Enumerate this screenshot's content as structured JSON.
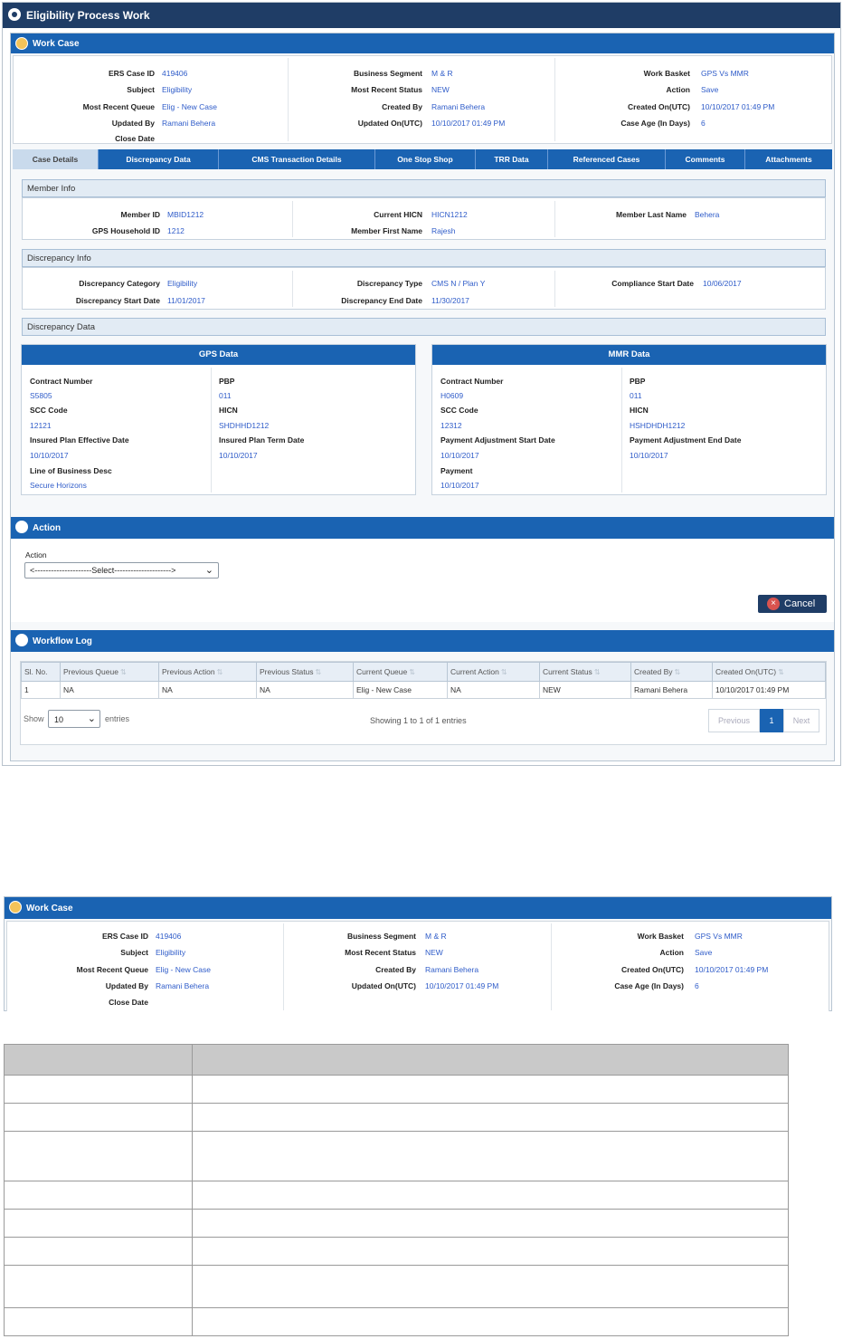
{
  "window": {
    "title": "Eligibility Process Work"
  },
  "work_case": {
    "title": "Work Case",
    "col1": [
      {
        "label": "ERS Case ID",
        "value": "419406"
      },
      {
        "label": "Subject",
        "value": "Eligibility"
      },
      {
        "label": "Most Recent Queue",
        "value": "Elig - New Case"
      },
      {
        "label": "Updated By",
        "value": "Ramani Behera"
      },
      {
        "label": "Close Date",
        "value": ""
      }
    ],
    "col2": [
      {
        "label": "Business Segment",
        "value": "M & R"
      },
      {
        "label": "Most Recent Status",
        "value": "NEW"
      },
      {
        "label": "Created By",
        "value": "Ramani Behera"
      },
      {
        "label": "Updated On(UTC)",
        "value": "10/10/2017 01:49 PM"
      }
    ],
    "col3": [
      {
        "label": "Work Basket",
        "value": "GPS Vs MMR"
      },
      {
        "label": "Action",
        "value": "Save"
      },
      {
        "label": "Created On(UTC)",
        "value": "10/10/2017 01:49 PM"
      },
      {
        "label": "Case Age (In Days)",
        "value": "6"
      }
    ]
  },
  "tabs": [
    "Case Details",
    "Discrepancy Data",
    "CMS Transaction Details",
    "One Stop Shop",
    "TRR Data",
    "Referenced Cases",
    "Comments",
    "Attachments"
  ],
  "member_info": {
    "title": "Member Info",
    "member_id": {
      "label": "Member ID",
      "value": "MBID1212"
    },
    "gps_household_id": {
      "label": "GPS Household ID",
      "value": "1212"
    },
    "current_hicn": {
      "label": "Current HICN",
      "value": "HICN1212"
    },
    "member_first_name": {
      "label": "Member First Name",
      "value": "Rajesh"
    },
    "member_last_name": {
      "label": "Member Last Name",
      "value": "Behera"
    }
  },
  "discrepancy_info": {
    "title": "Discrepancy Info",
    "category": {
      "label": "Discrepancy Category",
      "value": "Eligibility"
    },
    "start_date": {
      "label": "Discrepancy Start Date",
      "value": "11/01/2017"
    },
    "type": {
      "label": "Discrepancy Type",
      "value": "CMS N / Plan Y"
    },
    "end_date": {
      "label": "Discrepancy End Date",
      "value": "11/30/2017"
    },
    "compliance_start": {
      "label": "Compliance Start Date",
      "value": "10/06/2017"
    }
  },
  "discrepancy_data": {
    "title": "Discrepancy Data"
  },
  "gps_data": {
    "title": "GPS Data",
    "left": [
      {
        "label": "Contract Number",
        "value": "S5805"
      },
      {
        "label": "SCC Code",
        "value": "12121"
      },
      {
        "label": "Insured Plan Effective Date",
        "value": "10/10/2017"
      },
      {
        "label": "Line of Business Desc",
        "value": "Secure Horizons"
      }
    ],
    "right": [
      {
        "label": "PBP",
        "value": "011"
      },
      {
        "label": "HICN",
        "value": "SHDHHD1212"
      },
      {
        "label": "Insured Plan Term Date",
        "value": "10/10/2017"
      }
    ]
  },
  "mmr_data": {
    "title": "MMR Data",
    "left": [
      {
        "label": "Contract Number",
        "value": "H0609"
      },
      {
        "label": "SCC Code",
        "value": "12312"
      },
      {
        "label": "Payment Adjustment Start Date",
        "value": "10/10/2017"
      },
      {
        "label": "Payment",
        "value": "10/10/2017"
      }
    ],
    "right": [
      {
        "label": "PBP",
        "value": "011"
      },
      {
        "label": "HICN",
        "value": "HSHDHDH1212"
      },
      {
        "label": "Payment Adjustment End Date",
        "value": "10/10/2017"
      }
    ]
  },
  "action": {
    "title": "Action",
    "field_label": "Action",
    "select_value": "<---------------------Select--------------------->",
    "cancel_label": "Cancel"
  },
  "workflow_log": {
    "title": "Workflow Log",
    "columns": [
      "Sl. No.",
      "Previous Queue",
      "Previous Action",
      "Previous Status",
      "Current Queue",
      "Current Action",
      "Current Status",
      "Created By",
      "Created On(UTC)"
    ],
    "rows": [
      [
        "1",
        "NA",
        "NA",
        "NA",
        "Elig - New Case",
        "NA",
        "NEW",
        "Ramani Behera",
        "10/10/2017 01:49 PM"
      ]
    ],
    "show_label": "Show",
    "entries_value": "10",
    "entries_label": "entries",
    "info": "Showing 1 to 1 of 1 entries",
    "prev": "Previous",
    "page": "1",
    "next": "Next"
  },
  "doc_table": {
    "rows": 9
  }
}
